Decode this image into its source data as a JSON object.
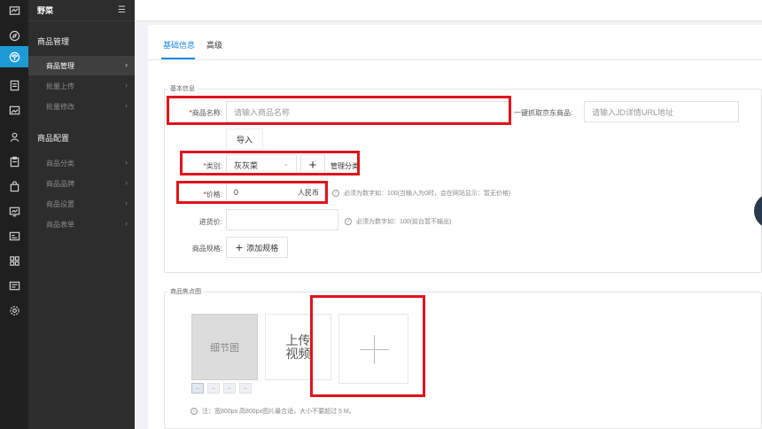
{
  "app": {
    "title": "野菜"
  },
  "rail_icons": [
    "chart-icon",
    "compass-icon",
    "cube-icon",
    "document-icon",
    "image-icon",
    "user-icon",
    "clipboard-icon",
    "bag-icon",
    "monitor-icon",
    "id-card-icon",
    "grid-icon",
    "profile-card-icon",
    "settings-icon"
  ],
  "sidebar": {
    "groups": [
      {
        "label": "商品管理",
        "items": [
          "商品管理",
          "批量上传",
          "批量修改"
        ]
      },
      {
        "label": "商品配置",
        "items": [
          "商品分类",
          "商品品牌",
          "商品设置",
          "商品表单"
        ]
      }
    ],
    "active_item": "商品管理",
    "arrow": "›"
  },
  "tabs": [
    "基础信息",
    "高级"
  ],
  "basic": {
    "legend": "基本信息",
    "name_label": "商品名称:",
    "name_placeholder": "请输入商品名称",
    "jd_label": "一键抓取京东商品:",
    "jd_placeholder": "请输入JD详情URL地址",
    "import_button": "导入",
    "category_label": "类别:",
    "category_value": "灰灰菜",
    "add_symbol": "+",
    "manage_category": "管理分类",
    "price_label": "价格:",
    "price_value": "0",
    "price_unit": "人民币",
    "price_hint": "必须为数字如：100(当输入为0时，会在网站显示：暂无价格)",
    "cost_label": "进货价:",
    "cost_hint": "必须为数字如：100(前台暂不输出)",
    "spec_label": "商品规格:",
    "add_spec": "添加规格",
    "required_mark": "*",
    "info_symbol": "i"
  },
  "gallery": {
    "legend": "商品焦点图",
    "detail_label": "细节图",
    "video_label_1": "上传",
    "video_label_2": "视频",
    "mini_arrow": "↔",
    "note": "注：宽800px 高800px图片最合适，大小不要超过 5 M。"
  },
  "colors": {
    "accent": "#1e88e5",
    "highlight": "#e0131d",
    "rail": "#1f1f1f",
    "sidebar": "#2d2d2d",
    "active_rail": "#1e9bd6"
  }
}
